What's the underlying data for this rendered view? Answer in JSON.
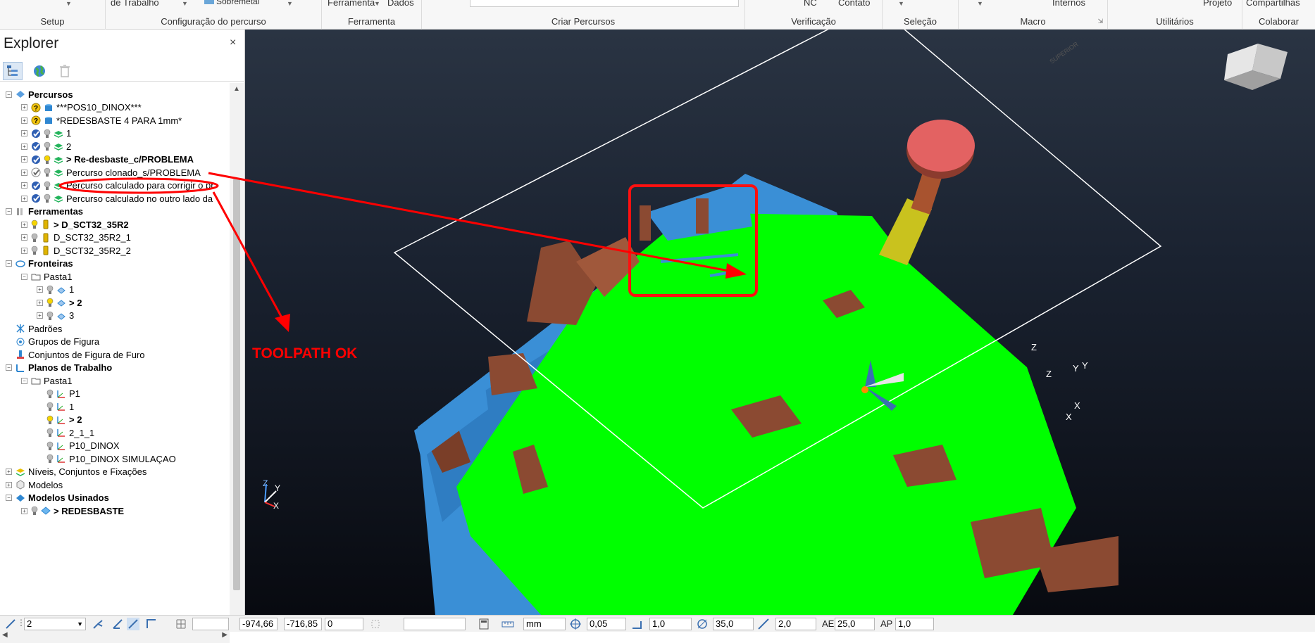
{
  "ribbon": {
    "groups": [
      {
        "label": "Setup"
      },
      {
        "label": "Configuração do percurso",
        "top": "de Trabalho"
      },
      {
        "label": "Ferramenta",
        "top": "Ferramenta",
        "top2": "Dados"
      },
      {
        "label": "Criar Percursos"
      },
      {
        "label": "Verificação",
        "top": "NC",
        "top2": "Contato"
      },
      {
        "label": "Seleção"
      },
      {
        "label": "Macro",
        "top": "Internos"
      },
      {
        "label": "Utilitários",
        "top": "Projeto"
      },
      {
        "label": "Colaborar",
        "top": "Compartilhas"
      }
    ],
    "partial_label": "Sobremetal"
  },
  "explorer": {
    "title": "Explorer",
    "close": "×",
    "toolbar_icons": [
      "explorer-tree-icon",
      "globe-icon",
      "trash-icon"
    ]
  },
  "tree": [
    {
      "indent": 0,
      "label": "Percursos",
      "bold": true,
      "icon": "toolpath-folder-icon",
      "collapse": true
    },
    {
      "indent": 1,
      "label": "***POS10_DINOX***",
      "icon": "cylinder-blue-icon",
      "status": "question"
    },
    {
      "indent": 1,
      "label": "*REDESBASTE 4 PARA 1mm*",
      "icon": "cylinder-blue-icon",
      "status": "question"
    },
    {
      "indent": 1,
      "label": "1",
      "icon": "layers-green-icon",
      "status": "check"
    },
    {
      "indent": 1,
      "label": "2",
      "icon": "layers-green-icon",
      "status": "check"
    },
    {
      "indent": 1,
      "label": "> Re-desbaste_c/PROBLEMA",
      "bold": true,
      "icon": "layers-green-icon",
      "status": "check",
      "bulb": "yellow"
    },
    {
      "indent": 1,
      "label": "Percurso clonado_s/PROBLEMA",
      "icon": "layers-green-icon",
      "status": "check-grey",
      "highlight": true
    },
    {
      "indent": 1,
      "label": "Percurso calculado para corrigir o pr",
      "icon": "layers-green-icon",
      "status": "check"
    },
    {
      "indent": 1,
      "label": "Percurso calculado no outro lado da",
      "icon": "layers-green-icon",
      "status": "check"
    },
    {
      "indent": 0,
      "label": "Ferramentas",
      "bold": true,
      "icon": "tools-folder-icon",
      "collapse": true
    },
    {
      "indent": 1,
      "label": "> D_SCT32_35R2",
      "bold": true,
      "icon": "tool-yellow-icon",
      "bulb": "yellow"
    },
    {
      "indent": 1,
      "label": "D_SCT32_35R2_1",
      "icon": "tool-yellow-icon"
    },
    {
      "indent": 1,
      "label": "D_SCT32_35R2_2",
      "icon": "tool-yellow-icon"
    },
    {
      "indent": 0,
      "label": "Fronteiras",
      "bold": true,
      "icon": "boundary-folder-icon",
      "collapse": true
    },
    {
      "indent": 1,
      "label": "Pasta1",
      "icon": "folder-icon",
      "collapse": true
    },
    {
      "indent": 2,
      "label": "1",
      "icon": "boundary-icon"
    },
    {
      "indent": 2,
      "label": "> 2",
      "bold": true,
      "icon": "boundary-icon",
      "bulb": "yellow"
    },
    {
      "indent": 2,
      "label": "3",
      "icon": "boundary-icon"
    },
    {
      "indent": 0,
      "label": "Padrões",
      "icon": "pattern-icon",
      "noexp": true
    },
    {
      "indent": 0,
      "label": "Grupos de Figura",
      "icon": "feature-group-icon",
      "noexp": true
    },
    {
      "indent": 0,
      "label": "Conjuntos de Figura de Furo",
      "icon": "hole-feature-icon",
      "noexp": true
    },
    {
      "indent": 0,
      "label": "Planos de Trabalho",
      "bold": true,
      "icon": "workplane-folder-icon",
      "collapse": true
    },
    {
      "indent": 1,
      "label": "Pasta1",
      "icon": "folder-icon",
      "collapse": true
    },
    {
      "indent": 2,
      "label": "P1",
      "icon": "workplane-icon",
      "noexp": true
    },
    {
      "indent": 2,
      "label": "1",
      "icon": "workplane-icon",
      "noexp": true
    },
    {
      "indent": 2,
      "label": "> 2",
      "bold": true,
      "icon": "workplane-icon",
      "noexp": true,
      "bulb": "yellow"
    },
    {
      "indent": 2,
      "label": "2_1_1",
      "icon": "workplane-icon",
      "noexp": true
    },
    {
      "indent": 2,
      "label": "P10_DINOX",
      "icon": "workplane-icon",
      "noexp": true
    },
    {
      "indent": 2,
      "label": "P10_DINOX SIMULAÇAO",
      "icon": "workplane-icon",
      "noexp": true
    },
    {
      "indent": 0,
      "label": "Níveis, Conjuntos e Fixações",
      "icon": "levels-icon"
    },
    {
      "indent": 0,
      "label": "Modelos",
      "icon": "models-icon"
    },
    {
      "indent": 0,
      "label": "Modelos Usinados",
      "bold": true,
      "icon": "stock-model-folder-icon",
      "collapse": true
    },
    {
      "indent": 1,
      "label": "> REDESBASTE",
      "bold": true,
      "icon": "stock-model-icon",
      "bulb": "grey"
    }
  ],
  "annotation": {
    "text": "TOOLPATH OK",
    "color": "#ff0000"
  },
  "viewport": {
    "background_top": "#2a3443",
    "background_bottom": "#080a10",
    "model_green": "#00ff00",
    "model_blue": "#3a8fd6",
    "model_brown": "#8b4a32",
    "tool_head": "#e36262",
    "tool_shank": "#c9c21e",
    "axis_labels": [
      "Z",
      "Y",
      "X"
    ],
    "triad_small_labels": [
      "Z",
      "Y",
      "X"
    ],
    "viewcube_label": "SUPERIOR"
  },
  "statusbar": {
    "workplane_select": "2",
    "coord_x": "-974,66",
    "coord_y": "-716,85",
    "coord_z": "0",
    "units": "mm",
    "tolerance": "0,05",
    "thickness": "1,0",
    "tool_diameter": "35,0",
    "stepover": "2,0",
    "ae_label": "AE",
    "ae_value": "25,0",
    "ap_label": "AP",
    "ap_value": "1,0"
  }
}
